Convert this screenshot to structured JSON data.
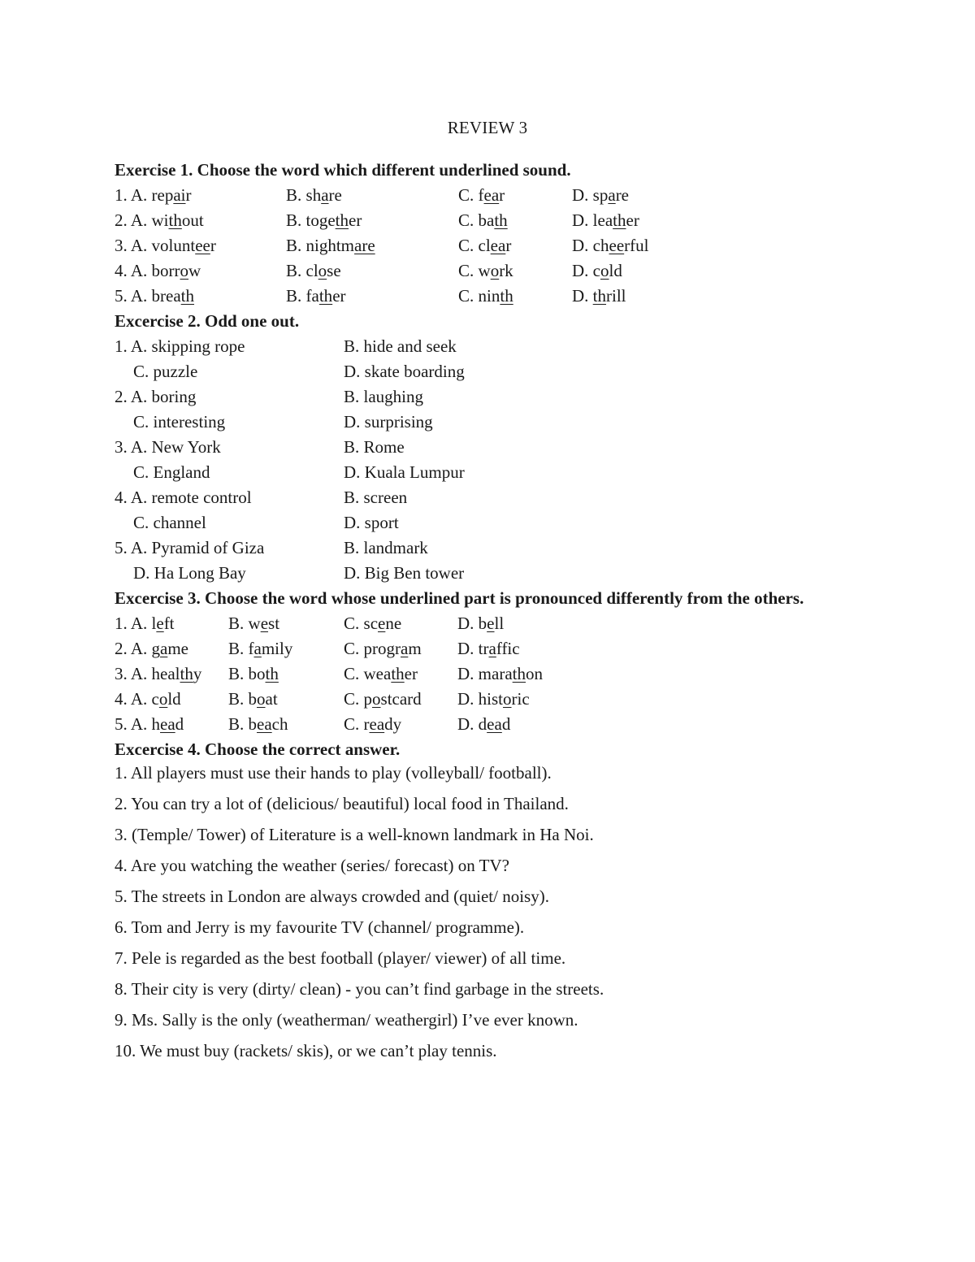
{
  "document": {
    "title": "REVIEW 3",
    "exercise1": {
      "heading": "Exercise 1. Choose the word which different underlined sound.",
      "rows": [
        {
          "num": "1.",
          "options": [
            {
              "letter": "A.",
              "word": [
                {
                  "t": "rep"
                },
                {
                  "t": "ai",
                  "u": true
                },
                {
                  "t": "r"
                }
              ]
            },
            {
              "letter": "B.",
              "word": [
                {
                  "t": "sh"
                },
                {
                  "t": "a",
                  "u": true
                },
                {
                  "t": "re"
                }
              ]
            },
            {
              "letter": "C.",
              "word": [
                {
                  "t": "f"
                },
                {
                  "t": "ea",
                  "u": true
                },
                {
                  "t": "r"
                }
              ]
            },
            {
              "letter": "D.",
              "word": [
                {
                  "t": "sp"
                },
                {
                  "t": "a",
                  "u": true
                },
                {
                  "t": "re"
                }
              ]
            }
          ]
        },
        {
          "num": "2.",
          "options": [
            {
              "letter": "A.",
              "word": [
                {
                  "t": "wi"
                },
                {
                  "t": "th",
                  "u": true
                },
                {
                  "t": "out"
                }
              ]
            },
            {
              "letter": "B.",
              "word": [
                {
                  "t": "toge"
                },
                {
                  "t": "th",
                  "u": true
                },
                {
                  "t": "er"
                }
              ]
            },
            {
              "letter": "C.",
              "word": [
                {
                  "t": "ba"
                },
                {
                  "t": "th",
                  "u": true
                }
              ]
            },
            {
              "letter": "D.",
              "word": [
                {
                  "t": "lea"
                },
                {
                  "t": "th",
                  "u": true
                },
                {
                  "t": "er"
                }
              ]
            }
          ]
        },
        {
          "num": "3.",
          "options": [
            {
              "letter": "A.",
              "word": [
                {
                  "t": "volunt"
                },
                {
                  "t": "ee",
                  "u": true
                },
                {
                  "t": "r"
                }
              ]
            },
            {
              "letter": "B.",
              "word": [
                {
                  "t": "nightm"
                },
                {
                  "t": "are",
                  "u": true
                }
              ]
            },
            {
              "letter": "C.",
              "word": [
                {
                  "t": "cl"
                },
                {
                  "t": "ea",
                  "u": true
                },
                {
                  "t": "r"
                }
              ]
            },
            {
              "letter": "D.",
              "word": [
                {
                  "t": "ch"
                },
                {
                  "t": "ee",
                  "u": true
                },
                {
                  "t": "rful"
                }
              ]
            }
          ]
        },
        {
          "num": "4.",
          "options": [
            {
              "letter": "A.",
              "word": [
                {
                  "t": "borr"
                },
                {
                  "t": "o",
                  "u": true
                },
                {
                  "t": "w"
                }
              ]
            },
            {
              "letter": "B.",
              "word": [
                {
                  "t": "cl"
                },
                {
                  "t": "o",
                  "u": true
                },
                {
                  "t": "se"
                }
              ]
            },
            {
              "letter": "C.",
              "word": [
                {
                  "t": "w"
                },
                {
                  "t": "o",
                  "u": true
                },
                {
                  "t": "rk"
                }
              ]
            },
            {
              "letter": "D.",
              "word": [
                {
                  "t": "c"
                },
                {
                  "t": "o",
                  "u": true
                },
                {
                  "t": "ld"
                }
              ]
            }
          ]
        },
        {
          "num": "5.",
          "options": [
            {
              "letter": "A.",
              "word": [
                {
                  "t": "brea"
                },
                {
                  "t": "th",
                  "u": true
                }
              ]
            },
            {
              "letter": "B.",
              "word": [
                {
                  "t": "fa"
                },
                {
                  "t": "th",
                  "u": true
                },
                {
                  "t": "er"
                }
              ]
            },
            {
              "letter": "C.",
              "word": [
                {
                  "t": "nin"
                },
                {
                  "t": "th",
                  "u": true
                }
              ]
            },
            {
              "letter": "D.",
              "word": [
                {
                  "t": "th",
                  "u": true
                },
                {
                  "t": "rill"
                }
              ]
            }
          ]
        }
      ]
    },
    "exercise2": {
      "heading": "Excercise 2. Odd one out.",
      "questions": [
        {
          "num": "1.",
          "lines": [
            [
              "A. skipping rope",
              "B. hide and seek"
            ],
            [
              "C. puzzle",
              "D. skate boarding"
            ]
          ]
        },
        {
          "num": "2.",
          "lines": [
            [
              "A. boring",
              "B. laughing"
            ],
            [
              "C. interesting",
              "D. surprising"
            ]
          ]
        },
        {
          "num": "3.",
          "lines": [
            [
              "A. New York",
              "B. Rome"
            ],
            [
              "C. England",
              "D. Kuala Lumpur"
            ]
          ]
        },
        {
          "num": "4.",
          "lines": [
            [
              "A. remote control",
              "B. screen"
            ],
            [
              "C. channel",
              "D. sport"
            ]
          ]
        },
        {
          "num": "5.",
          "lines": [
            [
              "A. Pyramid of Giza",
              "B. landmark"
            ],
            [
              "D. Ha Long Bay",
              "D. Big Ben tower"
            ]
          ]
        }
      ]
    },
    "exercise3": {
      "heading": "Excercise 3. Choose the word whose underlined part is pronounced differently from the others.",
      "rows": [
        {
          "num": "1.",
          "options": [
            {
              "letter": "A.",
              "word": [
                {
                  "t": "l"
                },
                {
                  "t": "e",
                  "u": true
                },
                {
                  "t": "ft"
                }
              ]
            },
            {
              "letter": "B.",
              "word": [
                {
                  "t": "w"
                },
                {
                  "t": "e",
                  "u": true
                },
                {
                  "t": "st"
                }
              ]
            },
            {
              "letter": "C.",
              "word": [
                {
                  "t": "sc"
                },
                {
                  "t": "e",
                  "u": true
                },
                {
                  "t": "ne"
                }
              ]
            },
            {
              "letter": "D.",
              "word": [
                {
                  "t": "b"
                },
                {
                  "t": "e",
                  "u": true
                },
                {
                  "t": "ll"
                }
              ]
            }
          ]
        },
        {
          "num": "2.",
          "options": [
            {
              "letter": "A.",
              "word": [
                {
                  "t": "g"
                },
                {
                  "t": "a",
                  "u": true
                },
                {
                  "t": "me"
                }
              ]
            },
            {
              "letter": "B.",
              "word": [
                {
                  "t": "f"
                },
                {
                  "t": "a",
                  "u": true
                },
                {
                  "t": "mily"
                }
              ]
            },
            {
              "letter": "C.",
              "word": [
                {
                  "t": "progr"
                },
                {
                  "t": "a",
                  "u": true
                },
                {
                  "t": "m"
                }
              ]
            },
            {
              "letter": "D.",
              "word": [
                {
                  "t": "tr"
                },
                {
                  "t": "a",
                  "u": true
                },
                {
                  "t": "ffic"
                }
              ]
            }
          ]
        },
        {
          "num": "3.",
          "options": [
            {
              "letter": "A.",
              "word": [
                {
                  "t": "heal"
                },
                {
                  "t": "th",
                  "u": true
                },
                {
                  "t": "y"
                }
              ]
            },
            {
              "letter": "B.",
              "word": [
                {
                  "t": "bo"
                },
                {
                  "t": "th",
                  "u": true
                }
              ]
            },
            {
              "letter": "C.",
              "word": [
                {
                  "t": "wea"
                },
                {
                  "t": "th",
                  "u": true
                },
                {
                  "t": "er"
                }
              ]
            },
            {
              "letter": "D.",
              "word": [
                {
                  "t": "mara"
                },
                {
                  "t": "th",
                  "u": true
                },
                {
                  "t": "on"
                }
              ]
            }
          ]
        },
        {
          "num": "4.",
          "options": [
            {
              "letter": "A.",
              "word": [
                {
                  "t": "c"
                },
                {
                  "t": "o",
                  "u": true
                },
                {
                  "t": "ld"
                }
              ]
            },
            {
              "letter": "B.",
              "word": [
                {
                  "t": "b"
                },
                {
                  "t": "o",
                  "u": true
                },
                {
                  "t": "at"
                }
              ]
            },
            {
              "letter": "C.",
              "word": [
                {
                  "t": "p"
                },
                {
                  "t": "o",
                  "u": true
                },
                {
                  "t": "stcard"
                }
              ]
            },
            {
              "letter": "D.",
              "word": [
                {
                  "t": "hist"
                },
                {
                  "t": "o",
                  "u": true
                },
                {
                  "t": "ric"
                }
              ]
            }
          ]
        },
        {
          "num": "5.",
          "options": [
            {
              "letter": "A.",
              "word": [
                {
                  "t": "h"
                },
                {
                  "t": "ea",
                  "u": true
                },
                {
                  "t": "d"
                }
              ]
            },
            {
              "letter": "B.",
              "word": [
                {
                  "t": "b"
                },
                {
                  "t": "ea",
                  "u": true
                },
                {
                  "t": "ch"
                }
              ]
            },
            {
              "letter": "C.",
              "word": [
                {
                  "t": "r"
                },
                {
                  "t": "ea",
                  "u": true
                },
                {
                  "t": "dy"
                }
              ]
            },
            {
              "letter": "D.",
              "word": [
                {
                  "t": "d"
                },
                {
                  "t": "ea",
                  "u": true
                },
                {
                  "t": "d"
                }
              ]
            }
          ]
        }
      ]
    },
    "exercise4": {
      "heading": "Excercise 4. Choose the correct answer.",
      "sentences": [
        "1. All players must use their hands to play (volleyball/ football).",
        "2. You can try a lot of (delicious/ beautiful) local food in Thailand.",
        "3. (Temple/ Tower) of Literature is a well-known landmark in Ha Noi.",
        "4. Are you watching the weather (series/ forecast) on TV?",
        "5. The streets in London are always crowded and (quiet/ noisy).",
        "6. Tom and Jerry is my favourite TV (channel/ programme).",
        "7. Pele is regarded as the best football (player/ viewer) of all time.",
        "8. Their city is very (dirty/ clean) - you can’t find garbage in the streets.",
        "9. Ms. Sally is the only (weatherman/ weathergirl) I’ve ever known.",
        "10. We must buy (rackets/ skis), or we can’t play tennis."
      ]
    }
  }
}
